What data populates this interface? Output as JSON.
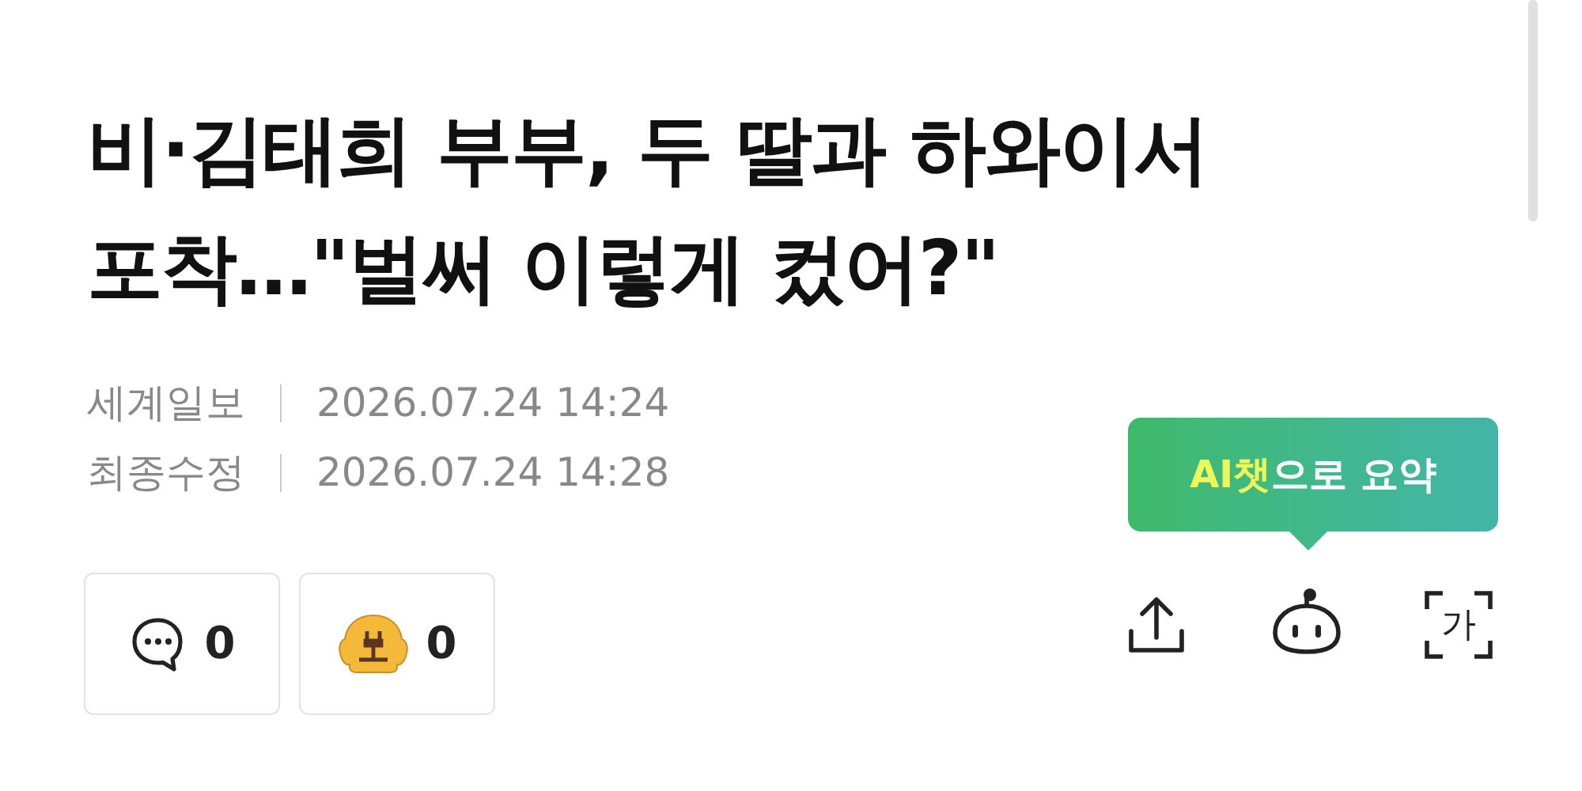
{
  "headline": "비·김태희 부부, 두 딸과 하와이서 포착…\"벌써 이렇게 컸어?\"",
  "meta": [
    {
      "label": "세계일보",
      "value": "2026.07.24 14:24"
    },
    {
      "label": "최종수정",
      "value": "2026.07.24 14:28"
    }
  ],
  "reactions": [
    {
      "kind": "comment",
      "count": "0"
    },
    {
      "kind": "emoji",
      "count": "0"
    }
  ],
  "tooltip": {
    "highlight": "AI챗",
    "rest": "으로 요약"
  },
  "font_size_icon": "가"
}
